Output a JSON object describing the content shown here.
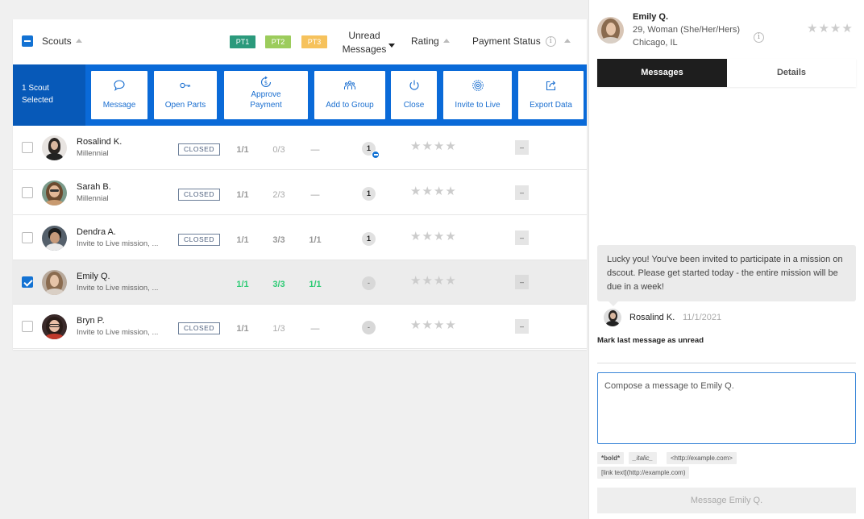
{
  "table": {
    "header": {
      "scouts_label": "Scouts",
      "pt1": "PT1",
      "pt2": "PT2",
      "pt3": "PT3",
      "unread_line1": "Unread",
      "unread_line2": "Messages",
      "rating": "Rating",
      "payment_status": "Payment Status",
      "info_glyph": "i"
    },
    "pt_colors": {
      "pt1": "#2b9a7c",
      "pt2": "#9ccc5c",
      "pt3": "#f6c25c"
    },
    "selection": {
      "line1": "1 Scout",
      "line2": "Selected"
    },
    "actions": {
      "message": "Message",
      "open_parts": "Open Parts",
      "approve_line1": "Approve",
      "approve_line2": "Payment",
      "add_to_group": "Add to Group",
      "close": "Close",
      "invite_to_live": "Invite to Live",
      "export_data": "Export Data"
    },
    "rows": [
      {
        "name": "Rosalind K.",
        "sub": "Millennial",
        "status": "CLOSED",
        "pt1": "1/1",
        "pt2": "0/3",
        "pt3": "—",
        "unread": "1",
        "stars": "★★★★",
        "payment": "–",
        "checked": false
      },
      {
        "name": "Sarah B.",
        "sub": "Millennial",
        "status": "CLOSED",
        "pt1": "1/1",
        "pt2": "2/3",
        "pt3": "—",
        "unread": "1",
        "stars": "★★★★",
        "payment": "–",
        "checked": false
      },
      {
        "name": "Dendra A.",
        "sub": "Invite to Live mission, ...",
        "status": "CLOSED",
        "pt1": "1/1",
        "pt2": "3/3",
        "pt3": "1/1",
        "unread": "1",
        "stars": "★★★★",
        "payment": "–",
        "checked": false
      },
      {
        "name": "Emily Q.",
        "sub": "Invite to Live mission, ...",
        "status": "",
        "pt1": "1/1",
        "pt2": "3/3",
        "pt3": "1/1",
        "unread": "-",
        "stars": "★★★★",
        "payment": "–",
        "checked": true
      },
      {
        "name": "Bryn P.",
        "sub": "Invite to Live mission, ...",
        "status": "CLOSED",
        "pt1": "1/1",
        "pt2": "1/3",
        "pt3": "—",
        "unread": "-",
        "stars": "★★★★",
        "payment": "–",
        "checked": false
      }
    ]
  },
  "panel": {
    "name": "Emily Q.",
    "desc": "29, Woman (She/Her/Hers)",
    "location": "Chicago, IL",
    "info_glyph": "i",
    "stars": "★★★★",
    "tabs": {
      "messages": "Messages",
      "details": "Details"
    },
    "message": {
      "text": "Lucky you! You've been invited to participate in a mission on dscout. Please get started today - the entire mission will be due in a week!",
      "sender": "Rosalind K.",
      "date": "11/1/2021"
    },
    "mark_unread": "Mark last message as unread",
    "compose_placeholder": "Compose a message to Emily Q.",
    "hints": {
      "bold": "*bold*",
      "italic": "_italic_",
      "link": "<http://example.com>",
      "link_text": "[link text](http://example.com)"
    },
    "send_label": "Message Emily Q."
  },
  "colors": {
    "accent_blue": "#0a6ad8",
    "accent_blue_dark": "#0759b8",
    "complete_green": "#2ecb75",
    "tab_active": "#1e1e1e"
  }
}
